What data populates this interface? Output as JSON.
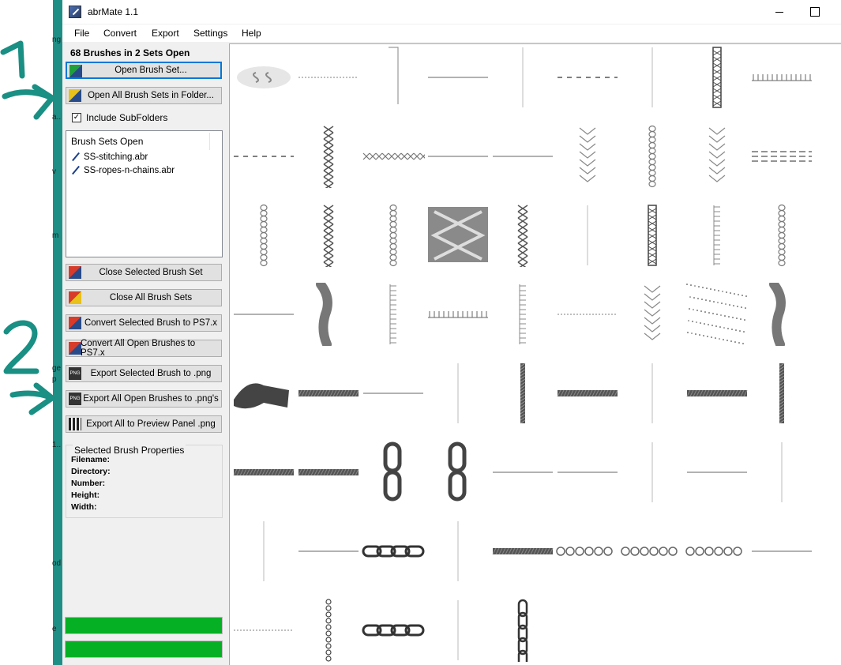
{
  "window": {
    "title": "abrMate 1.1"
  },
  "menu": [
    "File",
    "Convert",
    "Export",
    "Settings",
    "Help"
  ],
  "panel": {
    "sets_count": "68 Brushes in 2 Sets Open",
    "open_brush_set": "Open Brush Set...",
    "open_all_in_folder": "Open All Brush Sets in Folder...",
    "include_subfolders": "Include SubFolders",
    "include_subfolders_checked": true,
    "sets_header": "Brush Sets Open",
    "sets": [
      "SS-stitching.abr",
      "SS-ropes-n-chains.abr"
    ],
    "close_selected": "Close Selected Brush Set",
    "close_all": "Close All Brush Sets",
    "convert_selected": "Convert Selected Brush to PS7.x",
    "convert_all": "Convert All Open Brushes to PS7.x",
    "export_selected_png": "Export Selected Brush to .png",
    "export_all_png": "Export All Open Brushes to .png's",
    "export_preview_png": "Export All to Preview Panel .png",
    "props_title": "Selected Brush Properties",
    "props": [
      "Filename:",
      "Directory:",
      "Number:",
      "Height:",
      "Width:"
    ],
    "progress": [
      1.0,
      1.0
    ]
  },
  "annotations": [
    "1",
    "2"
  ],
  "desktop_glyphs": [
    "ng",
    "a..",
    "v",
    "m",
    "ge",
    "p",
    "1..",
    "od",
    "e"
  ],
  "preview": {
    "brushes": [
      [
        "ss-logo-icon",
        "thin-dash-h",
        "zigzag-v",
        "line-h",
        "thin-v",
        "dash-h",
        "thin-v",
        "ladder-v",
        "comb-h"
      ],
      [
        "dash-h",
        "x-stitch-v",
        "x-stitch-h",
        "line-h",
        "line-h",
        "chevron-v",
        "braid-v",
        "chevron-v",
        "double-dash-h"
      ],
      [
        "braid-v",
        "x-stitch-v",
        "braid-v",
        "lacing-panel",
        "x-stitch-v",
        "thin-v",
        "ladder-v",
        "comb-v",
        "braid-v"
      ],
      [
        "line-h",
        "rope-tassel",
        "comb-v",
        "comb-h",
        "comb-v",
        "thin-dash-h",
        "chevron-v",
        "speckle-block",
        "rope-tassel"
      ],
      [
        "rope-end",
        "rope-h",
        "line-h",
        "thin-v",
        "rope-v",
        "rope-h",
        "thin-v",
        "rope-h",
        "rope-v"
      ],
      [
        "rope-h",
        "rope-h",
        "chain-link-v",
        "chain-link-v",
        "line-h",
        "line-h",
        "thin-v",
        "line-h",
        "thin-v"
      ],
      [
        "thin-v",
        "line-h",
        "chain-h",
        "thin-v",
        "rope-h",
        "ring-chain-h",
        "ring-chain-h",
        "ring-chain-h",
        "line-h"
      ],
      [
        "thin-dash-h",
        "bead-chain-v",
        "chain-h",
        "thin-v",
        "chain-v",
        "",
        "",
        "",
        ""
      ]
    ]
  }
}
